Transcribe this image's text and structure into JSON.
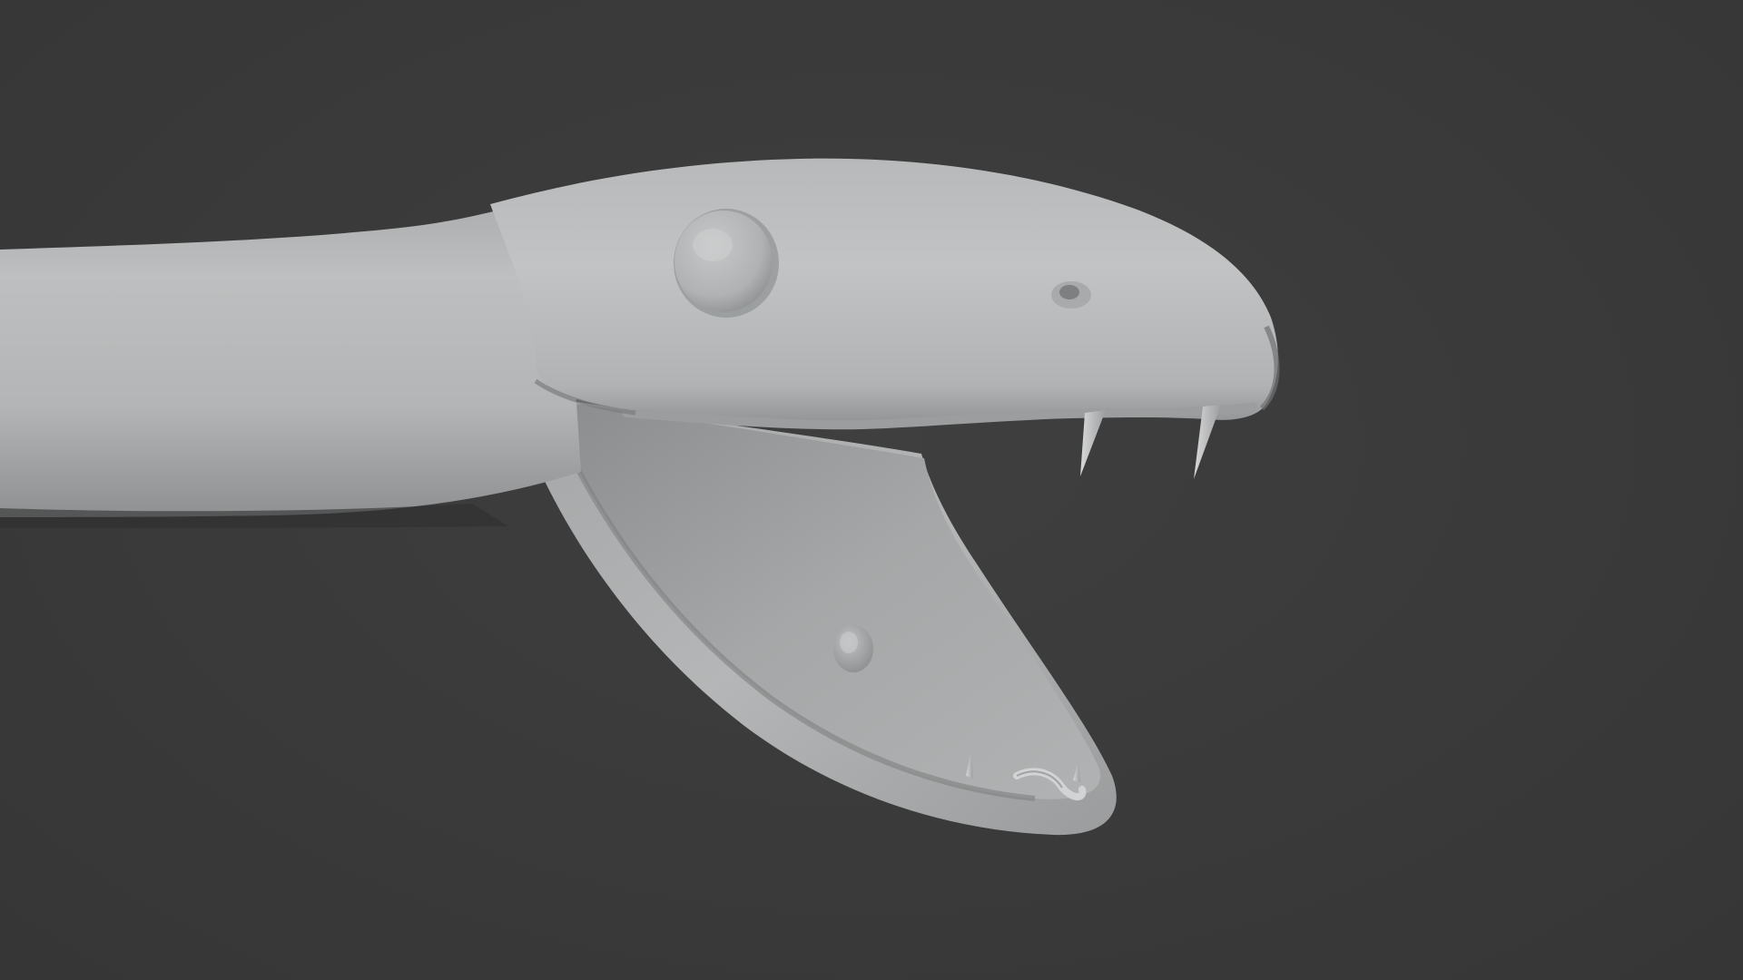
{
  "viewport": {
    "background_color": "#3b3b3b",
    "shading": "solid-gray-clay"
  },
  "model": {
    "subject": "snake-head",
    "material_color": "#b9bbbc",
    "mouth_state": "open",
    "parts": [
      "neck",
      "upper-jaw",
      "lower-jaw",
      "eye",
      "nostril",
      "upper-fangs",
      "lower-teeth",
      "tongue-tip",
      "glottis"
    ]
  }
}
